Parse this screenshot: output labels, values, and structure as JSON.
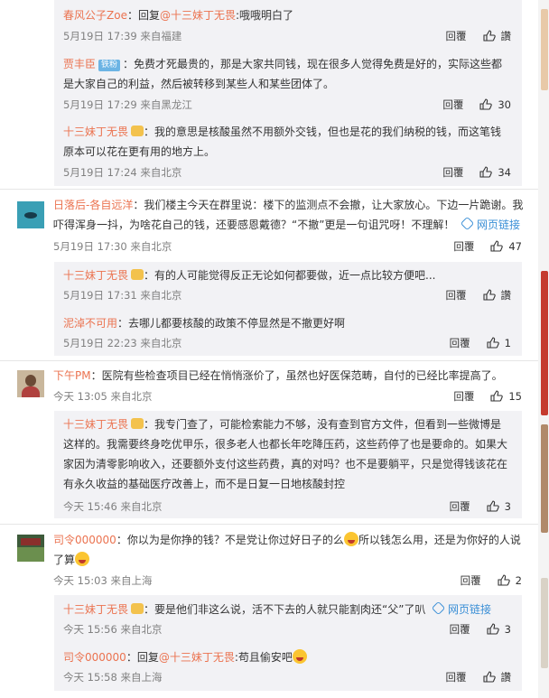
{
  "like_icon": "thumb-up-icon",
  "comments": [
    {
      "id": "c1",
      "name": "春风公子Zoe",
      "sep": "：",
      "reply_label": "回复",
      "reply_to": "@十三妹丁无畏",
      "text": ":哦哦明白了",
      "time": "5月19日 17:39",
      "loc": "来自福建",
      "reply_btn": "回覆",
      "like": "讚"
    },
    {
      "id": "c2",
      "name": "贾丰臣",
      "badge": "铁粉",
      "sep": "：",
      "lines": [
        "免费才死最贵的，那是大家共同钱，现在很多人觉得免费是好的，实际这些都",
        "是大家自己的利益，然后被转移到某些人和某些团体了。"
      ],
      "time": "5月19日 17:29",
      "loc": "来自黑龙江",
      "reply_btn": "回覆",
      "like": "30"
    },
    {
      "id": "c3",
      "name": "十三妹丁无畏",
      "sep": "：",
      "lines": [
        "我的意思是核酸虽然不用额外交钱，但也是花的我们纳税的钱，而这笔钱",
        "原本可以花在更有用的地方上。"
      ],
      "time": "5月19日 17:24",
      "loc": "来自北京",
      "reply_btn": "回覆",
      "like": "34"
    },
    {
      "id": "c4",
      "name": "日落后-各自远洋",
      "sep": "：",
      "lines": [
        "我们楼主今天在群里说：楼下的监测点不会撤，让大家放心。下边一片跪谢。我",
        "吓得浑身一抖，为啥花自己的钱，还要感恩戴德？“不撤”更是一句诅咒呀！不理解！"
      ],
      "link": "网页链接",
      "time": "5月19日 17:30",
      "loc": "来自北京",
      "reply_btn": "回覆",
      "like": "47"
    },
    {
      "id": "c5",
      "name": "十三妹丁无畏",
      "sep": "：",
      "text": "有的人可能觉得反正无论如何都要做，近一点比较方便吧...",
      "time": "5月19日 17:31",
      "loc": "来自北京",
      "reply_btn": "回覆",
      "like": "讚"
    },
    {
      "id": "c6",
      "name": "泥淖不可用",
      "sep": "：",
      "text": "去哪儿都要核酸的政策不停显然是不撤更好啊",
      "time": "5月19日 22:23",
      "loc": "来自北京",
      "reply_btn": "回覆",
      "like": "1"
    },
    {
      "id": "c7",
      "name": "下午PM",
      "sep": "：",
      "text": "医院有些检查项目已经在悄悄涨价了，虽然也好医保范畴，自付的已经比率提高了。",
      "time": "今天 13:05",
      "loc": "来自北京",
      "reply_btn": "回覆",
      "like": "15"
    },
    {
      "id": "c8",
      "name": "十三妹丁无畏",
      "sep": "：",
      "lines": [
        "我专门查了，可能检索能力不够，没有查到官方文件，但看到一些微博是",
        "这样的。我需要终身吃优甲乐，很多老人也都长年吃降压药，这些药停了也是要命的。如果大",
        "家因为清零影响收入，还要额外支付这些药费，真的对吗？也不是要躺平，只是觉得钱该花在",
        "有永久收益的基础医疗改善上，而不是日复一日地核酸封控"
      ],
      "time": "今天 15:46",
      "loc": "来自北京",
      "reply_btn": "回覆",
      "like": "3"
    },
    {
      "id": "c9",
      "name": "司令000000",
      "sep": "：",
      "line1a": "你以为是你挣的钱？不是党让你过好日子的么",
      "line1b": "所以钱怎么用，还是为你好的人说",
      "line2": "了算",
      "time": "今天 15:03",
      "loc": "来自上海",
      "reply_btn": "回覆",
      "like": "2"
    },
    {
      "id": "c10",
      "name": "十三妹丁无畏",
      "sep": "：",
      "text": "要是他们非这么说，活不下去的人就只能割肉还“父”了叭",
      "link": "网页链接",
      "time": "今天 15:56",
      "loc": "来自北京",
      "reply_btn": "回覆",
      "like": "3"
    },
    {
      "id": "c11",
      "name": "司令000000",
      "sep": "：",
      "reply_label": "回复",
      "reply_to": "@十三妹丁无畏",
      "text": ":苟且偷安吧",
      "time": "今天 15:58",
      "loc": "来自上海",
      "reply_btn": "回覆",
      "like": "讚"
    }
  ]
}
